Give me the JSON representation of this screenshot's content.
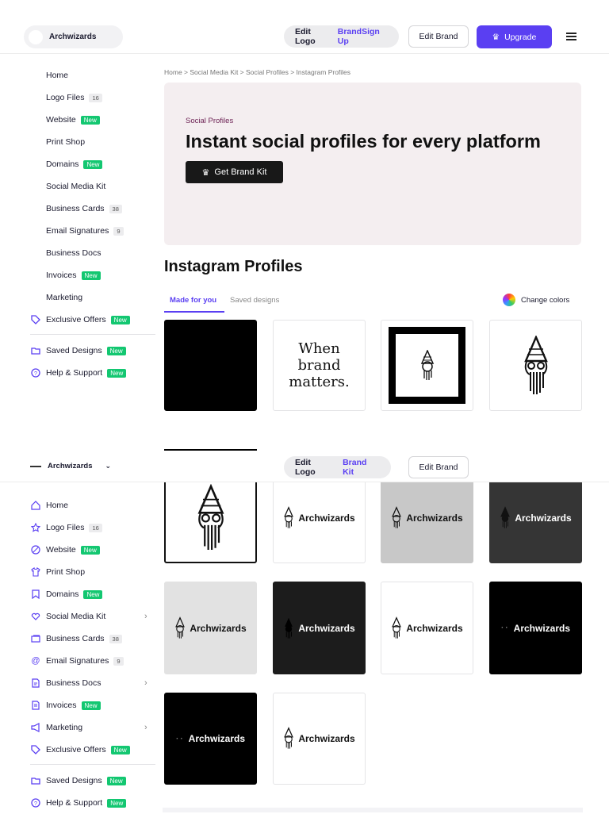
{
  "header": {
    "brand_name": "Archwizards",
    "edit_logo": "Edit Logo",
    "brand_kit": "Brand Kit",
    "brand_kit_overlap": "BrandSign Up",
    "edit_brand": "Edit Brand",
    "upgrade": "Upgrade"
  },
  "sidebar": {
    "items": [
      {
        "label": "Home"
      },
      {
        "label": "Logo Files",
        "count": "16"
      },
      {
        "label": "Website",
        "badge": "New"
      },
      {
        "label": "Print Shop"
      },
      {
        "label": "Domains",
        "badge": "New"
      },
      {
        "label": "Social Media Kit"
      },
      {
        "label": "Business Cards",
        "count": "38"
      },
      {
        "label": "Email Signatures",
        "count": "9"
      },
      {
        "label": "Business Docs"
      },
      {
        "label": "Invoices",
        "badge": "New"
      },
      {
        "label": "Marketing"
      },
      {
        "label": "Exclusive Offers",
        "badge": "New"
      },
      {
        "label": "Saved Designs",
        "badge": "New"
      },
      {
        "label": "Help & Support",
        "badge": "New"
      }
    ]
  },
  "breadcrumb": "Home  >  Social Media Kit  >  Social Profiles  >  Instagram Profiles",
  "hero": {
    "kicker": "Social Profiles",
    "title": "Instant social profiles for every platform",
    "cta": "Get Brand Kit"
  },
  "section": {
    "title": "Instagram Profiles",
    "tab_made": "Made for you",
    "tab_saved": "Saved designs",
    "change_colors": "Change colors"
  },
  "cards": {
    "tagline": "When brand matters.",
    "wordmark": "Archwizards"
  },
  "colors": {
    "accent": "#5a3ff2",
    "new_badge": "#13c771",
    "hero_bg": "#f4eef0",
    "kicker": "#6b1f52"
  }
}
